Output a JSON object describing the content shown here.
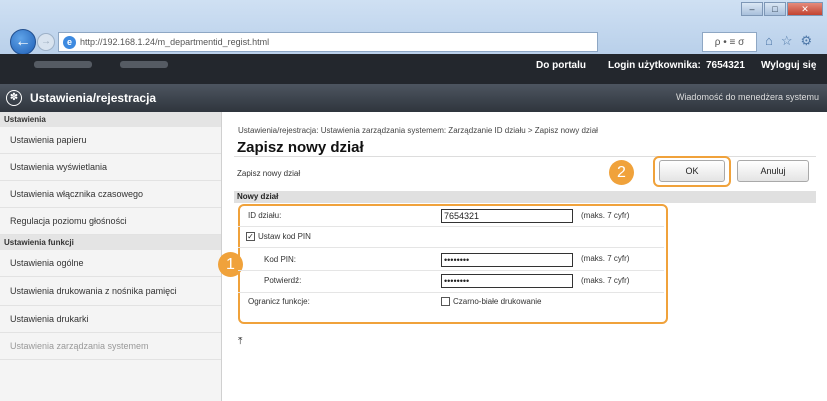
{
  "browser": {
    "url": "http://192.168.1.24/m_departmentid_regist.html",
    "addr_tools": "ρ • ≡ σ",
    "win_min": "–",
    "win_max": "□",
    "win_close": "✕",
    "back_icon": "arrow-left-icon",
    "icons": [
      "home-icon",
      "star-icon",
      "gear-icon"
    ]
  },
  "topbar": {
    "portal_link": "Do portalu",
    "login_label": "Login użytkownika:",
    "login_user": "7654321",
    "logout_link": "Wyloguj się"
  },
  "header": {
    "title": "Ustawienia/rejestracja",
    "message": "Wiadomość do menedżera systemu"
  },
  "sidebar": {
    "section1": "Ustawienia",
    "items1": [
      "Ustawienia papieru",
      "Ustawienia wyświetlania",
      "Ustawienia włącznika czasowego",
      "Regulacja poziomu głośności"
    ],
    "section2": "Ustawienia funkcji",
    "items2": [
      "Ustawienia ogólne",
      "Ustawienia drukowania z nośnika pamięci",
      "Ustawienia drukarki"
    ],
    "section3": "Ustawienia zarządzania systemem"
  },
  "main": {
    "breadcrumb": "Ustawienia/rejestracja: Ustawienia zarządzania systemem: Zarządzanie ID działu > Zapisz nowy dział",
    "title": "Zapisz nowy dział",
    "sub_label": "Zapisz nowy dział",
    "ok_label": "OK",
    "cancel_label": "Anuluj",
    "section_label": "Nowy dział",
    "badge1": "1",
    "badge2": "2",
    "form": {
      "id_label": "ID działu:",
      "id_value": "7654321",
      "id_hint": "(maks. 7 cyfr)",
      "set_pin_label": "Ustaw kod PIN",
      "set_pin_checked": true,
      "pin_label": "Kod PIN:",
      "pin_value": "••••••••",
      "pin_hint": "(maks. 7 cyfr)",
      "confirm_label": "Potwierdź:",
      "confirm_value": "••••••••",
      "confirm_hint": "(maks. 7 cyfr)",
      "restrict_label": "Ogranicz funkcje:",
      "bw_label": "Czarno-białe drukowanie",
      "bw_checked": false
    },
    "to_top": "⤒"
  },
  "colors": {
    "highlight": "#f0a23b",
    "topbar": "#23272d"
  }
}
